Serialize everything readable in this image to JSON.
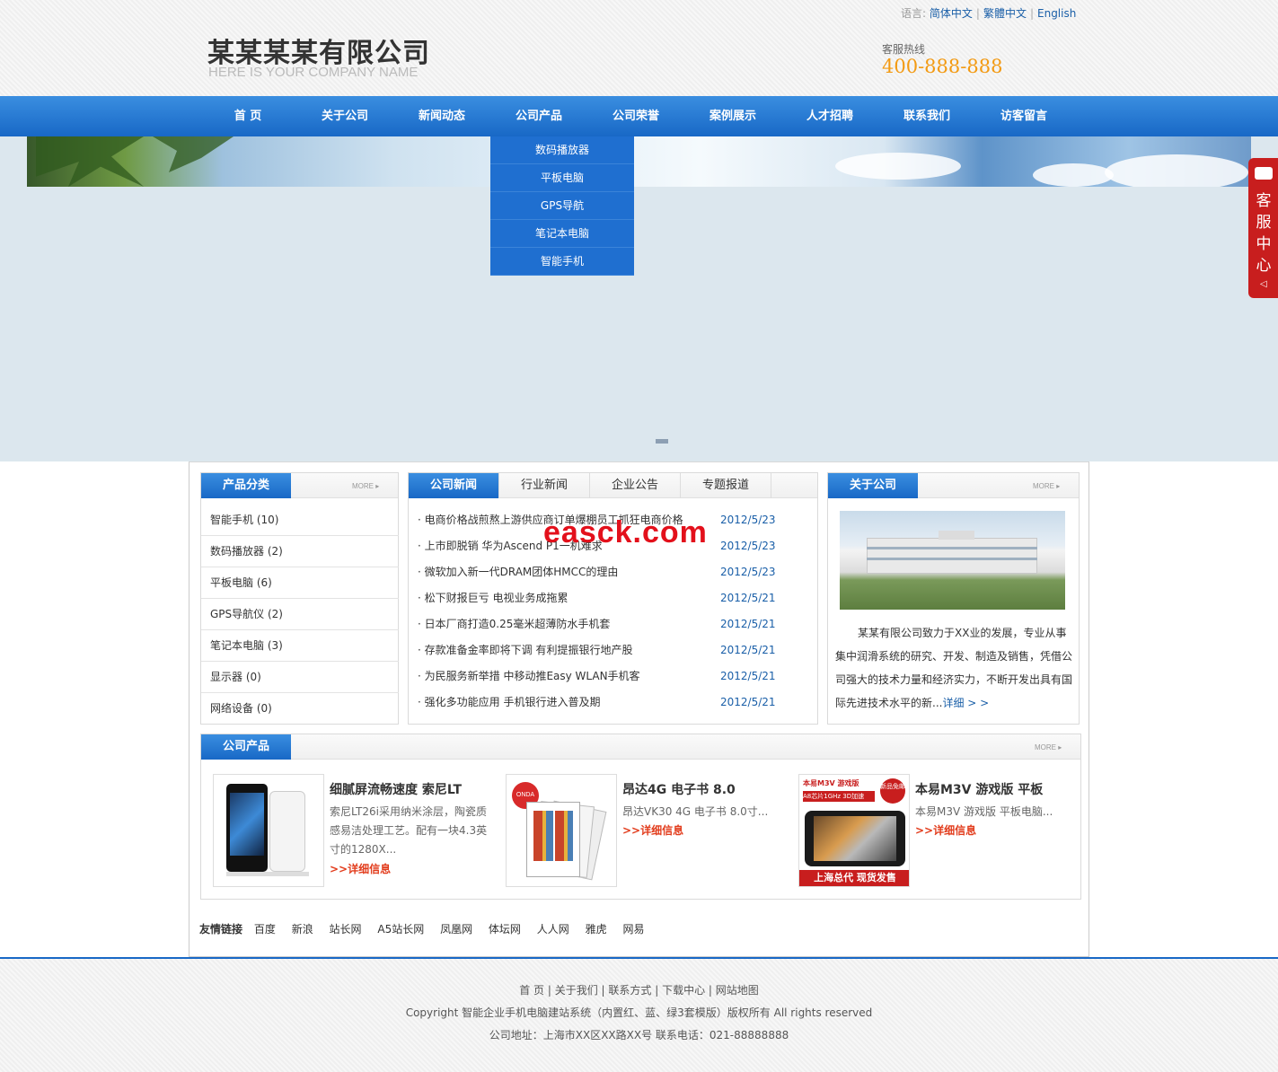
{
  "header": {
    "logo_cn": "某某某某有限公司",
    "logo_en": "HERE IS YOUR COMPANY NAME",
    "lang_label": "语言:",
    "lang_options": [
      "简体中文",
      "繁體中文",
      "English"
    ],
    "hotline_label": "客服热线",
    "hotline": "400-888-888"
  },
  "nav": {
    "items": [
      "首 页",
      "关于公司",
      "新闻动态",
      "公司产品",
      "公司荣誉",
      "案例展示",
      "人才招聘",
      "联系我们",
      "访客留言"
    ],
    "dropdown": [
      "数码播放器",
      "平板电脑",
      "GPS导航",
      "笔记本电脑",
      "智能手机"
    ]
  },
  "service": {
    "label": "客服中心"
  },
  "categories": {
    "title": "产品分类",
    "more": "MORE ▸",
    "items": [
      "智能手机 (10)",
      "数码播放器 (2)",
      "平板电脑 (6)",
      "GPS导航仪 (2)",
      "笔记本电脑 (3)",
      "显示器 (0)",
      "网络设备 (0)"
    ]
  },
  "news": {
    "tabs": [
      "公司新闻",
      "行业新闻",
      "企业公告",
      "专题报道"
    ],
    "items": [
      {
        "title": "· 电商价格战煎熬上游供应商订单爆棚员工抓狂电商价格",
        "date": "2012/5/23"
      },
      {
        "title": "· 上市即脱销 华为Ascend P1一机难求",
        "date": "2012/5/23"
      },
      {
        "title": "· 微软加入新一代DRAM团体HMCC的理由",
        "date": "2012/5/23"
      },
      {
        "title": "· 松下财报巨亏 电视业务成拖累",
        "date": "2012/5/21"
      },
      {
        "title": "· 日本厂商打造0.25毫米超薄防水手机套",
        "date": "2012/5/21"
      },
      {
        "title": "· 存款准备金率即将下调 有利提振银行地产股",
        "date": "2012/5/21"
      },
      {
        "title": "· 为民服务新举措 中移动推Easy WLAN手机客",
        "date": "2012/5/21"
      },
      {
        "title": "· 强化多功能应用 手机银行进入普及期",
        "date": "2012/5/21"
      }
    ]
  },
  "about": {
    "title": "关于公司",
    "more": "MORE ▸",
    "text": "某某有限公司致力于XX业的发展，专业从事集中润滑系统的研究、开发、制造及销售，凭借公司强大的技术力量和经济实力，不断开发出具有国际先进技术水平的新...",
    "detail_link": "详细 > >"
  },
  "products": {
    "title": "公司产品",
    "more": "MORE ▸",
    "items": [
      {
        "title": "细腻屏流畅速度 索尼LT",
        "desc": "索尼LT26i采用纳米涂层，陶瓷质感易洁处理工艺。配有一块4.3英寸的1280X...",
        "more": ">>详细信息"
      },
      {
        "title": "昂达4G 电子书 8.0",
        "desc": "昂达VK30 4G 电子书 8.0寸...",
        "more": ">>详细信息"
      },
      {
        "title": "本易M3V 游戏版 平板",
        "desc": "本易M3V 游戏版 平板电脑...",
        "more": ">>详细信息"
      }
    ],
    "img3_top": "本易M3V 游戏版",
    "img3_spec": "A8芯片1GHz 3D加速",
    "img3_badge": "新品免邮",
    "img3_bottom": "上海总代 现货发售",
    "img2_logo": "ONDA"
  },
  "links": {
    "label": "友情链接",
    "items": [
      "百度",
      "新浪",
      "站长网",
      "A5站长网",
      "凤凰网",
      "体坛网",
      "人人网",
      "雅虎",
      "网易"
    ]
  },
  "footer": {
    "nav": [
      "首 页",
      "关于我们",
      "联系方式",
      "下载中心",
      "网站地图"
    ],
    "copyright": "Copyright 智能企业手机电脑建站系统（内置红、蓝、绿3套模版）版权所有 All rights reserved",
    "address": "公司地址：上海市XX区XX路XX号 联系电话：021-88888888"
  },
  "watermark": "easck.com",
  "colors": {
    "nav_blue": "#1868c6",
    "accent_orange": "#f39a12",
    "service_red": "#c81e1e",
    "link_blue": "#1a5fa8",
    "more_red": "#e23c1c"
  }
}
